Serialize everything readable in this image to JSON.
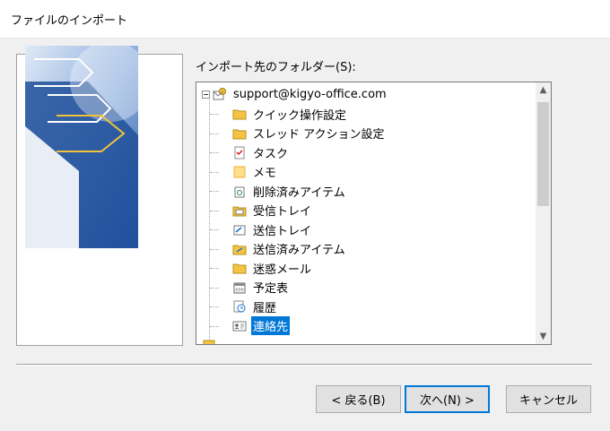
{
  "window": {
    "title": "ファイルのインポート"
  },
  "folder_label": "インポート先のフォルダー(S):",
  "tree": {
    "root": "support@kigyo-office.com",
    "items": [
      {
        "label": "クイック操作設定",
        "icon": "folder-icon"
      },
      {
        "label": "スレッド アクション設定",
        "icon": "folder-icon"
      },
      {
        "label": "タスク",
        "icon": "task-icon"
      },
      {
        "label": "メモ",
        "icon": "note-icon"
      },
      {
        "label": "削除済みアイテム",
        "icon": "trash-icon"
      },
      {
        "label": "受信トレイ",
        "icon": "inbox-icon"
      },
      {
        "label": "送信トレイ",
        "icon": "outbox-icon"
      },
      {
        "label": "送信済みアイテム",
        "icon": "sent-icon"
      },
      {
        "label": "迷惑メール",
        "icon": "folder-icon"
      },
      {
        "label": "予定表",
        "icon": "calendar-icon"
      },
      {
        "label": "履歴",
        "icon": "journal-icon"
      },
      {
        "label": "連絡先",
        "icon": "contacts-icon",
        "selected": true
      }
    ]
  },
  "buttons": {
    "back": "< 戻る(B)",
    "next": "次へ(N) >",
    "cancel": "キャンセル"
  },
  "colors": {
    "selection": "#0078d7",
    "folder": "#f5c342"
  }
}
